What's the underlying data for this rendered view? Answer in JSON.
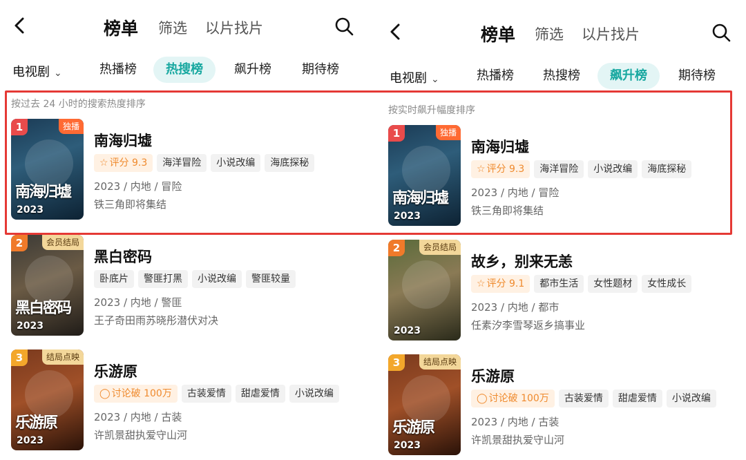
{
  "left": {
    "header": {
      "title": "榜单",
      "tab_filter": "筛选",
      "tab_find": "以片找片"
    },
    "category": "电视剧",
    "rank_tabs": [
      "热播榜",
      "热搜榜",
      "飙升榜",
      "期待榜"
    ],
    "active_tab": 1,
    "hint": "按过去 24 小时的搜索热度排序",
    "items": [
      {
        "rank": "1",
        "ribbon": "独播",
        "year": "2023",
        "poster_text": "南海归墟",
        "name": "南海归墟",
        "tags": [
          "评分 9.3",
          "海洋冒险",
          "小说改编",
          "海底探秘"
        ],
        "meta": "2023 / 内地 / 冒险",
        "desc": "铁三角即将集结"
      },
      {
        "rank": "2",
        "ribbon": "会员结局",
        "year": "2023",
        "poster_text": "黑白密码",
        "name": "黑白密码",
        "tags": [
          "卧底片",
          "警匪打黑",
          "小说改编",
          "警匪较量"
        ],
        "meta": "2023 / 内地 / 警匪",
        "desc": "王子奇田雨苏晓彤潜伏对决"
      },
      {
        "rank": "3",
        "ribbon": "结局点映",
        "year": "2023",
        "poster_text": "乐游原",
        "name": "乐游原",
        "tags": [
          "讨论破 100万",
          "古装爱情",
          "甜虐爱情",
          "小说改编"
        ],
        "meta": "2023 / 内地 / 古装",
        "desc": "许凯景甜执爱守山河"
      }
    ]
  },
  "right": {
    "header": {
      "title": "榜单",
      "tab_filter": "筛选",
      "tab_find": "以片找片"
    },
    "category": "电视剧",
    "rank_tabs": [
      "热播榜",
      "热搜榜",
      "飙升榜",
      "期待榜"
    ],
    "active_tab": 2,
    "hint": "按实时飙升幅度排序",
    "items": [
      {
        "rank": "1",
        "ribbon": "独播",
        "year": "2023",
        "poster_text": "南海归墟",
        "name": "南海归墟",
        "tags": [
          "评分 9.3",
          "海洋冒险",
          "小说改编",
          "海底探秘"
        ],
        "meta": "2023 / 内地 / 冒险",
        "desc": "铁三角即将集结"
      },
      {
        "rank": "2",
        "ribbon": "会员结局",
        "year": "2023",
        "poster_text": "",
        "name": "故乡，别来无恙",
        "tags": [
          "评分 9.1",
          "都市生活",
          "女性题材",
          "女性成长"
        ],
        "meta": "2023 / 内地 / 都市",
        "desc": "任素汐李雪琴返乡搞事业"
      },
      {
        "rank": "3",
        "ribbon": "结局点映",
        "year": "2023",
        "poster_text": "乐游原",
        "name": "乐游原",
        "tags": [
          "讨论破 100万",
          "古装爱情",
          "甜虐爱情",
          "小说改编"
        ],
        "meta": "2023 / 内地 / 古装",
        "desc": "许凯景甜执爱守山河"
      }
    ]
  },
  "colors": {
    "accent": "#18a8a0",
    "rank1": "#e94b4b",
    "rank2": "#f07a2a",
    "rank3": "#f3a72b",
    "highlight": "#e53935"
  },
  "icons": {
    "back": "chevron-left-icon",
    "search": "search-icon",
    "score": "star-outline-icon",
    "discuss": "speech-bubble-icon"
  }
}
